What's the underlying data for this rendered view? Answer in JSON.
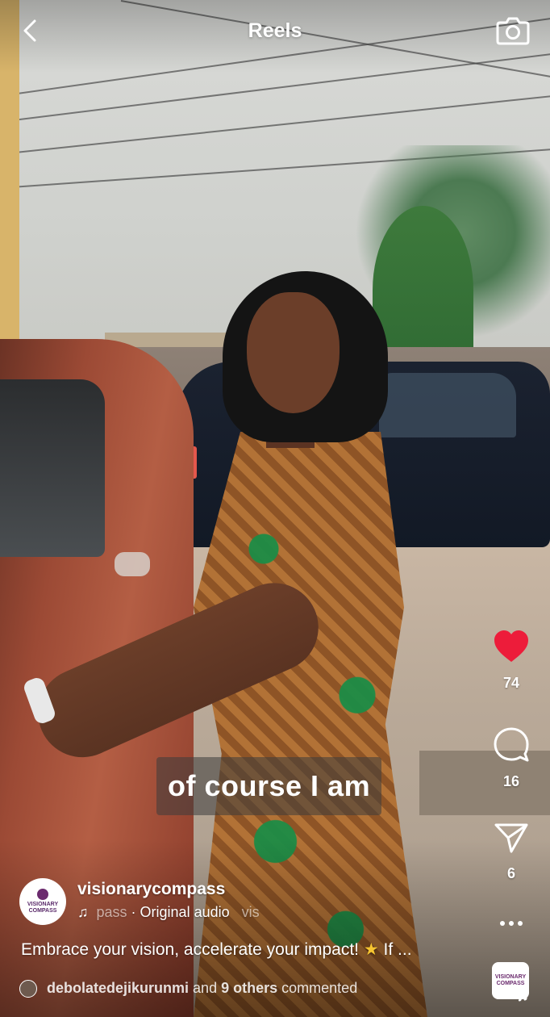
{
  "header": {
    "title": "Reels"
  },
  "video": {
    "subtitle": "of course I am"
  },
  "actions": {
    "likes": "74",
    "comments": "16",
    "shares": "6",
    "like_color": "#ed1c3a"
  },
  "post": {
    "username": "visionarycompass",
    "avatar_text": "VISIONARY COMPASS",
    "audio_prefix": "pass",
    "audio_label": "· Original audio",
    "audio_suffix": "vis",
    "description": "Embrace your vision, accelerate your impact!",
    "description_more": "If ...",
    "commenter": "debolatedejikurunmi",
    "comment_and": "and",
    "comment_others": "9 others",
    "comment_suffix": "commented"
  },
  "icons": {
    "back": "chevron-left-icon",
    "camera": "camera-icon",
    "like": "heart-icon",
    "comment": "comment-bubble-icon",
    "share": "paper-plane-icon",
    "more": "ellipsis-icon",
    "audio": "music-note-icon",
    "star": "star-emoji-icon"
  }
}
